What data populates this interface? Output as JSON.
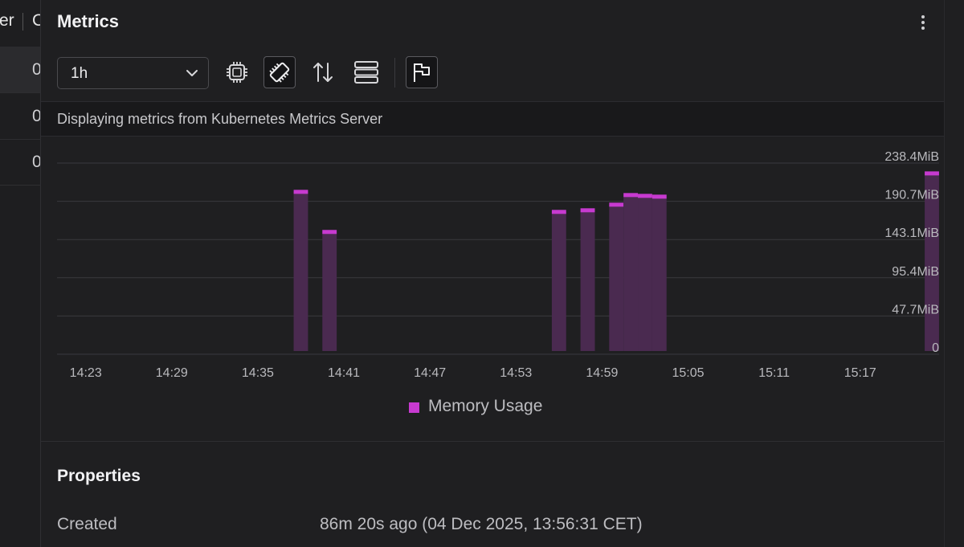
{
  "background_table": {
    "header_text": "er",
    "header_text2": "C",
    "rows": [
      "0",
      "0",
      "0"
    ]
  },
  "panel": {
    "title": "Metrics",
    "menu_icon": "kebab-vertical-icon",
    "time_range": {
      "selected": "1h"
    },
    "toolbar": {
      "icons": [
        "cpu-icon",
        "memory-icon",
        "network-arrows-icon",
        "filesystem-icon",
        "flag-icon"
      ],
      "active": "memory-icon"
    },
    "info_text": "Displaying metrics from Kubernetes Metrics Server",
    "legend_label": "Memory Usage",
    "properties_title": "Properties",
    "created_label": "Created",
    "created_value": "86m 20s ago (04 Dec 2025, 13:56:31 CET)"
  },
  "colors": {
    "accent": "#c73ad0",
    "bar_fill": "#4a2a50",
    "grid": "#3a3a3e"
  },
  "chart_data": {
    "type": "bar",
    "series": [
      {
        "name": "Memory Usage",
        "unit": "MiB"
      }
    ],
    "x_ticks": [
      "14:23",
      "14:29",
      "14:35",
      "14:41",
      "14:47",
      "14:53",
      "14:59",
      "15:05",
      "15:11",
      "15:17"
    ],
    "y_ticks": [
      "0",
      "47.7MiB",
      "95.4MiB",
      "143.1MiB",
      "190.7MiB",
      "238.4MiB"
    ],
    "y_max": 238.4,
    "ylim": [
      0,
      238.4
    ],
    "points": [
      {
        "time": "14:38",
        "value": 202
      },
      {
        "time": "14:40",
        "value": 152
      },
      {
        "time": "14:56",
        "value": 177
      },
      {
        "time": "14:58",
        "value": 179
      },
      {
        "time": "15:00",
        "value": 186
      },
      {
        "time": "15:01",
        "value": 198
      },
      {
        "time": "15:02",
        "value": 197
      },
      {
        "time": "15:03",
        "value": 196
      },
      {
        "time": "15:22",
        "value": 225
      }
    ],
    "grid": true,
    "y_axis_position": "right",
    "legend_position": "bottom-center"
  }
}
